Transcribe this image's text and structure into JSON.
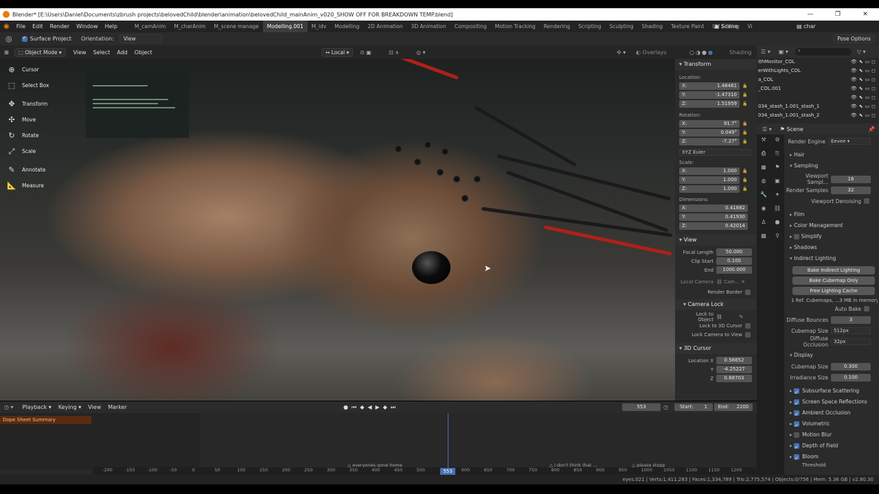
{
  "titlebar": {
    "text": "Blender* [E:\\Users\\Daniel\\Documents\\zbrush projects\\belovedChild\\blender\\animation\\belovedChild_mainAnim_v020_SHOW OFF FOR BREAKDOWN TEMP.blend]",
    "min": "—",
    "max": "❐",
    "close": "✕"
  },
  "menu": [
    "File",
    "Edit",
    "Render",
    "Window",
    "Help"
  ],
  "workspaces": [
    "M_camAnim",
    "M_charAnim",
    "M_scene manage",
    "Modelling.001",
    "M_ldv",
    "Modelling",
    "2D Animation",
    "3D Animation",
    "Compositing",
    "Motion Tracking",
    "Rendering",
    "Scripting",
    "Sculpting",
    "Shading",
    "Texture Paint",
    "UV Editing",
    "Vi"
  ],
  "active_workspace_index": 3,
  "scene_name": "Scene",
  "view_layer": "char",
  "toolhdr": {
    "surface_project": "Surface Project",
    "orientation_label": "Orientation:",
    "orientation_value": "View",
    "pose_options": "Pose Options"
  },
  "vphdr": {
    "mode": "Object Mode",
    "menus": [
      "View",
      "Select",
      "Add",
      "Object"
    ],
    "transform_orient": "Local",
    "overlays": "Overlays",
    "shading": "Shading"
  },
  "tools": [
    {
      "label": "Cursor",
      "icon": "cursor-icon"
    },
    {
      "label": "Select Box",
      "icon": "select-box-icon"
    },
    {
      "label": "Transform",
      "icon": "transform-icon"
    },
    {
      "label": "Move",
      "icon": "move-icon"
    },
    {
      "label": "Rotate",
      "icon": "rotate-icon"
    },
    {
      "label": "Scale",
      "icon": "scale-icon"
    },
    {
      "label": "Annotate",
      "icon": "annotate-icon"
    },
    {
      "label": "Measure",
      "icon": "measure-icon"
    }
  ],
  "npanel": {
    "transform_title": "Transform",
    "location_label": "Location:",
    "location": {
      "x": "1.48461",
      "y": "-1.47310",
      "z": "1.51959"
    },
    "rotation_label": "Rotation:",
    "rotation": {
      "x": "91.7°",
      "y": "0.049°",
      "z": "-7.27°"
    },
    "rotation_mode": "XYZ Euler",
    "scale_label": "Scale:",
    "scale": {
      "x": "1.000",
      "y": "1.000",
      "z": "1.000"
    },
    "dimensions_label": "Dimensions:",
    "dimensions": {
      "x": "0.41882",
      "y": "0.41930",
      "z": "0.42014"
    },
    "view_title": "View",
    "focal_length_label": "Focal Length",
    "focal_length": "50.000",
    "clip_start_label": "Clip Start",
    "clip_start": "0.100",
    "clip_end_label": "End",
    "clip_end": "1000.000",
    "local_camera_label": "Local Camera",
    "local_camera_value": "Cam...",
    "render_border_label": "Render Border",
    "camera_lock_title": "Camera Lock",
    "lock_to_object_label": "Lock to Object",
    "lock_to_3d_cursor_label": "Lock to 3D Cursor",
    "lock_camera_to_view_label": "Lock Camera to View",
    "cursor_title": "3D Cursor",
    "cursor_loc_x_label": "Location X",
    "cursor_loc_y_label": "Y",
    "cursor_loc_z_label": "Z",
    "cursor": {
      "x": "0.56652",
      "y": "-4.25227",
      "z": "0.68703"
    },
    "axis_x": "X:",
    "axis_y": "Y:",
    "axis_z": "Z:"
  },
  "outliner": {
    "rows": [
      "ithMonitor_COL",
      "erWithLights_COL",
      "a_COL",
      "_COL.001",
      "",
      "034_stash_1.001_stash_1",
      "034_stash_1.001_stash_2"
    ]
  },
  "properties": {
    "scene_label": "Scene",
    "render_engine_label": "Render Engine",
    "render_engine": "Eevee",
    "hair": "Hair",
    "sampling": "Sampling",
    "viewport_samples_label": "Viewport Sampl...",
    "viewport_samples": "16",
    "render_samples_label": "Render Samples",
    "render_samples": "32",
    "viewport_denoising": "Viewport Denoising",
    "film": "Film",
    "color_management": "Color Management",
    "simplify": "Simplify",
    "shadows": "Shadows",
    "indirect_lighting": "Indirect Lighting",
    "bake_indirect": "Bake Indirect Lighting",
    "bake_cubemap": "Bake Cubemap Only",
    "free_cache": "Free Lighting Cache",
    "cache_info": "1 Ref. Cubemaps, ...3 MB in memory)",
    "auto_bake": "Auto Bake",
    "diffuse_bounces_label": "Diffuse Bounces",
    "diffuse_bounces": "3",
    "cubemap_size_label": "Cubemap Size",
    "cubemap_size": "512px",
    "diffuse_occlusion_label": "Diffuse Occlusion",
    "diffuse_occlusion": "32px",
    "display": "Display",
    "disp_cubemap_size_label": "Cubemap Size",
    "disp_cubemap_size": "0.300",
    "irradiance_size_label": "Irradiance Size",
    "irradiance_size": "0.100",
    "effects": [
      {
        "label": "Subsurface Scattering",
        "on": true
      },
      {
        "label": "Screen Space Reflections",
        "on": true
      },
      {
        "label": "Ambient Occlusion",
        "on": true
      },
      {
        "label": "Volumetric",
        "on": true
      },
      {
        "label": "Motion Blur",
        "on": false
      },
      {
        "label": "Depth of Field",
        "on": true
      },
      {
        "label": "Bloom",
        "on": true
      }
    ],
    "threshold": "Threshold"
  },
  "timeline": {
    "menus": [
      "Playback",
      "Keying",
      "View",
      "Marker"
    ],
    "current_frame": "553",
    "start_label": "Start:",
    "start": "1",
    "end_label": "End:",
    "end": "2200",
    "summary": "Dope Sheet Summary",
    "ticks": [
      "-200",
      "-150",
      "-100",
      "-50",
      "0",
      "50",
      "100",
      "150",
      "200",
      "250",
      "300",
      "350",
      "400",
      "450",
      "500",
      "553",
      "600",
      "650",
      "700",
      "750",
      "800",
      "850",
      "900",
      "950",
      "1000",
      "1050",
      "1100",
      "1150",
      "1200"
    ],
    "markers": [
      "△ everyones gone home",
      "△ I don't think that ...",
      "△ please stopp"
    ]
  },
  "status": "eyes.021 | Verts:1,411,283 | Faces:1,334,789 | Tris:2,775,574 | Objects:0/756 | Mem: 5.36 GB | v2.80.30"
}
